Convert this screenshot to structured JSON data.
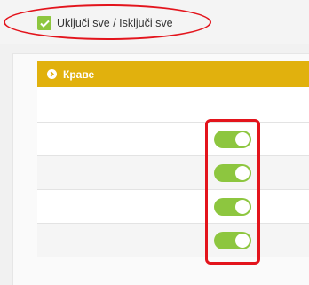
{
  "toggle_all": {
    "label": "Uključi sve / Isključi sve",
    "checked": true
  },
  "section": {
    "title": "Краве",
    "header_color": "#e1b10d"
  },
  "rows": [
    {
      "has_toggle": false
    },
    {
      "has_toggle": true,
      "on": true
    },
    {
      "has_toggle": true,
      "on": true
    },
    {
      "has_toggle": true,
      "on": true
    },
    {
      "has_toggle": true,
      "on": true
    }
  ],
  "colors": {
    "accent_green": "#8dc63f",
    "highlight_red": "#e3141c"
  }
}
